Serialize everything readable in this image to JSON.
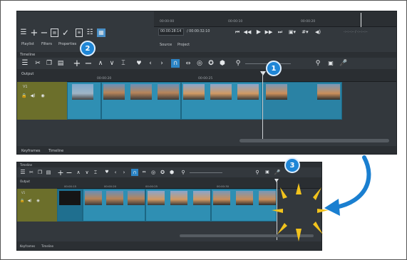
{
  "colors": {
    "panel_bg": "#33383d",
    "accent_blue": "#1f86d6",
    "clip_blue": "#2f8fb3",
    "track_header_olive": "#6c6f2b",
    "arrow_blue": "#1a7fd0",
    "spark_yellow": "#f2c31d"
  },
  "top": {
    "ruler_times": [
      "00:00:00",
      "00:00:10",
      "00:00:20"
    ],
    "tabs": [
      "Playlist",
      "Filters",
      "Properties"
    ],
    "timecode": "00:00:28:14",
    "duration": "/ 00:00:32:10",
    "source_tabs": [
      "Source",
      "Project"
    ],
    "right_timecode": "-:--:--:-- / -:--:--:--",
    "timeline_title": "Timeline",
    "output_label": "Output",
    "track_label": "V1",
    "time_marks": [
      "00:00:20",
      "00:00:25"
    ],
    "bottom_tabs": [
      "Keyframes",
      "Timeline"
    ]
  },
  "bottom": {
    "timeline_title": "Timeline",
    "output_label": "Output",
    "track_label": "V1",
    "time_marks": [
      "00:00:15",
      "00:00:20",
      "00:00:25",
      "00:00:30"
    ],
    "bottom_tabs": [
      "Keyframes",
      "Timeline"
    ]
  },
  "callouts": [
    "1",
    "2",
    "3"
  ]
}
